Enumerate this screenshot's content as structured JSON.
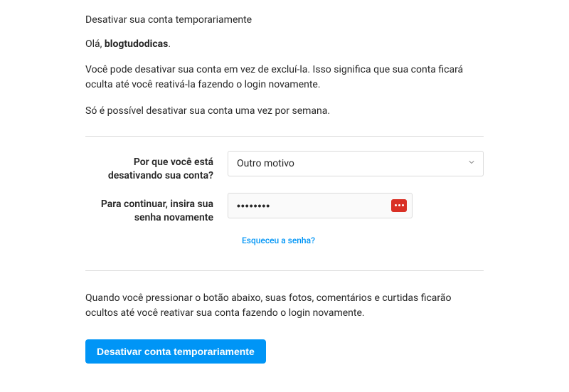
{
  "title": "Desativar sua conta temporariamente",
  "greeting": {
    "prefix": "Olá, ",
    "username": "blogtudodicas",
    "suffix": "."
  },
  "desc1": "Você pode desativar sua conta em vez de excluí-la. Isso significa que sua conta ficará oculta até você reativá-la fazendo o login novamente.",
  "desc2": "Só é possível desativar sua conta uma vez por semana.",
  "form": {
    "reason": {
      "label": "Por que você está desativando sua conta?",
      "selected": "Outro motivo"
    },
    "password": {
      "label": "Para continuar, insira sua senha novamente",
      "value": "••••••••"
    },
    "forgot": "Esqueceu a senha?"
  },
  "footnote": "Quando você pressionar o botão abaixo, suas fotos, comentários e curtidas ficarão ocultos até você reativar sua conta fazendo o login novamente.",
  "submit": "Desativar conta temporariamente"
}
